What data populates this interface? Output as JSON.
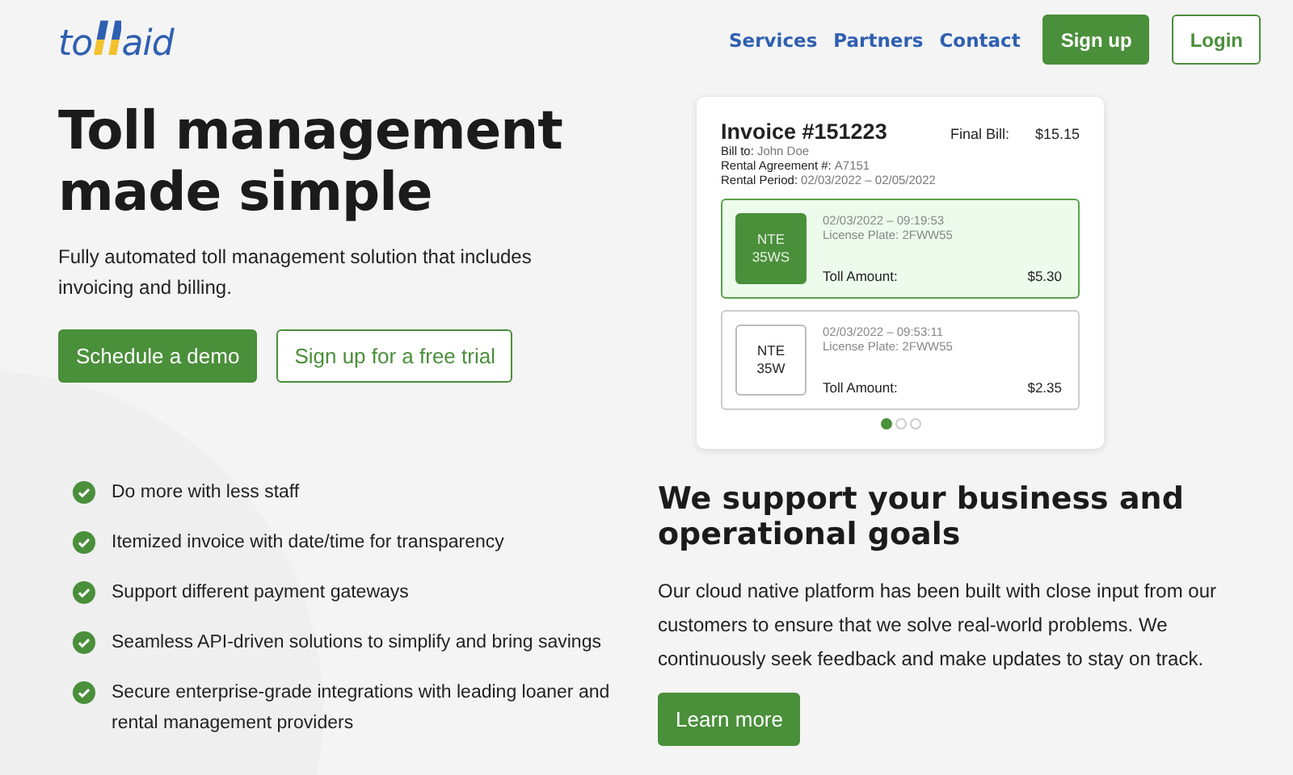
{
  "logo": {
    "parts": [
      {
        "text": "to",
        "kind": "plain"
      },
      {
        "text": "ll",
        "kind": "accent"
      },
      {
        "text": "aid",
        "kind": "plain"
      }
    ]
  },
  "nav": {
    "links": [
      "Services",
      "Partners",
      "Contact"
    ],
    "buttons": [
      {
        "label": "Sign up",
        "kind": "primary"
      },
      {
        "label": "Login",
        "kind": "outline"
      }
    ]
  },
  "hero": {
    "title": "Toll management made simple",
    "subtitle": "Fully automated toll management solution that includes invoicing and billing.",
    "buttons": [
      {
        "label": "Schedule a demo",
        "kind": "primary"
      },
      {
        "label": "Sign up for a free trial",
        "kind": "outline"
      }
    ]
  },
  "invoice": {
    "title": "Invoice #151223",
    "final_label": "Final Bill:",
    "final_value": "$15.15",
    "details": [
      {
        "label": "Bill to:",
        "value": "John Doe"
      },
      {
        "label": "Rental Agreement #:",
        "value": "A7151"
      },
      {
        "label": "Rental Period:",
        "value": "02/03/2022 – 02/05/2022"
      }
    ],
    "tolls": [
      {
        "road": "NTE",
        "lane": "35WS",
        "datetime": "02/03/2022 – 09:19:53",
        "plate": "License Plate: 2FWW55",
        "amount_label": "Toll Amount:",
        "amount": "$5.30",
        "selected": true
      },
      {
        "road": "NTE",
        "lane": "35W",
        "datetime": "02/03/2022 – 09:53:11",
        "plate": "License Plate: 2FWW55",
        "amount_label": "Toll Amount:",
        "amount": "$2.35",
        "selected": false
      }
    ],
    "dots": [
      {
        "selected": true
      },
      {
        "selected": false
      },
      {
        "selected": false
      }
    ]
  },
  "features": [
    "Do more with less staff",
    "Itemized invoice with date/time for transparency",
    "Support different payment gateways",
    "Seamless API-driven solutions to simplify and bring savings",
    "Secure enterprise-grade integrations with leading loaner and rental management providers"
  ],
  "support": {
    "title": "We support your business and operational goals",
    "text": "Our cloud native platform has been built with close input from our customers to ensure that we solve real-world problems. We continuously seek feedback and make updates to stay on track.",
    "button": "Learn more"
  }
}
